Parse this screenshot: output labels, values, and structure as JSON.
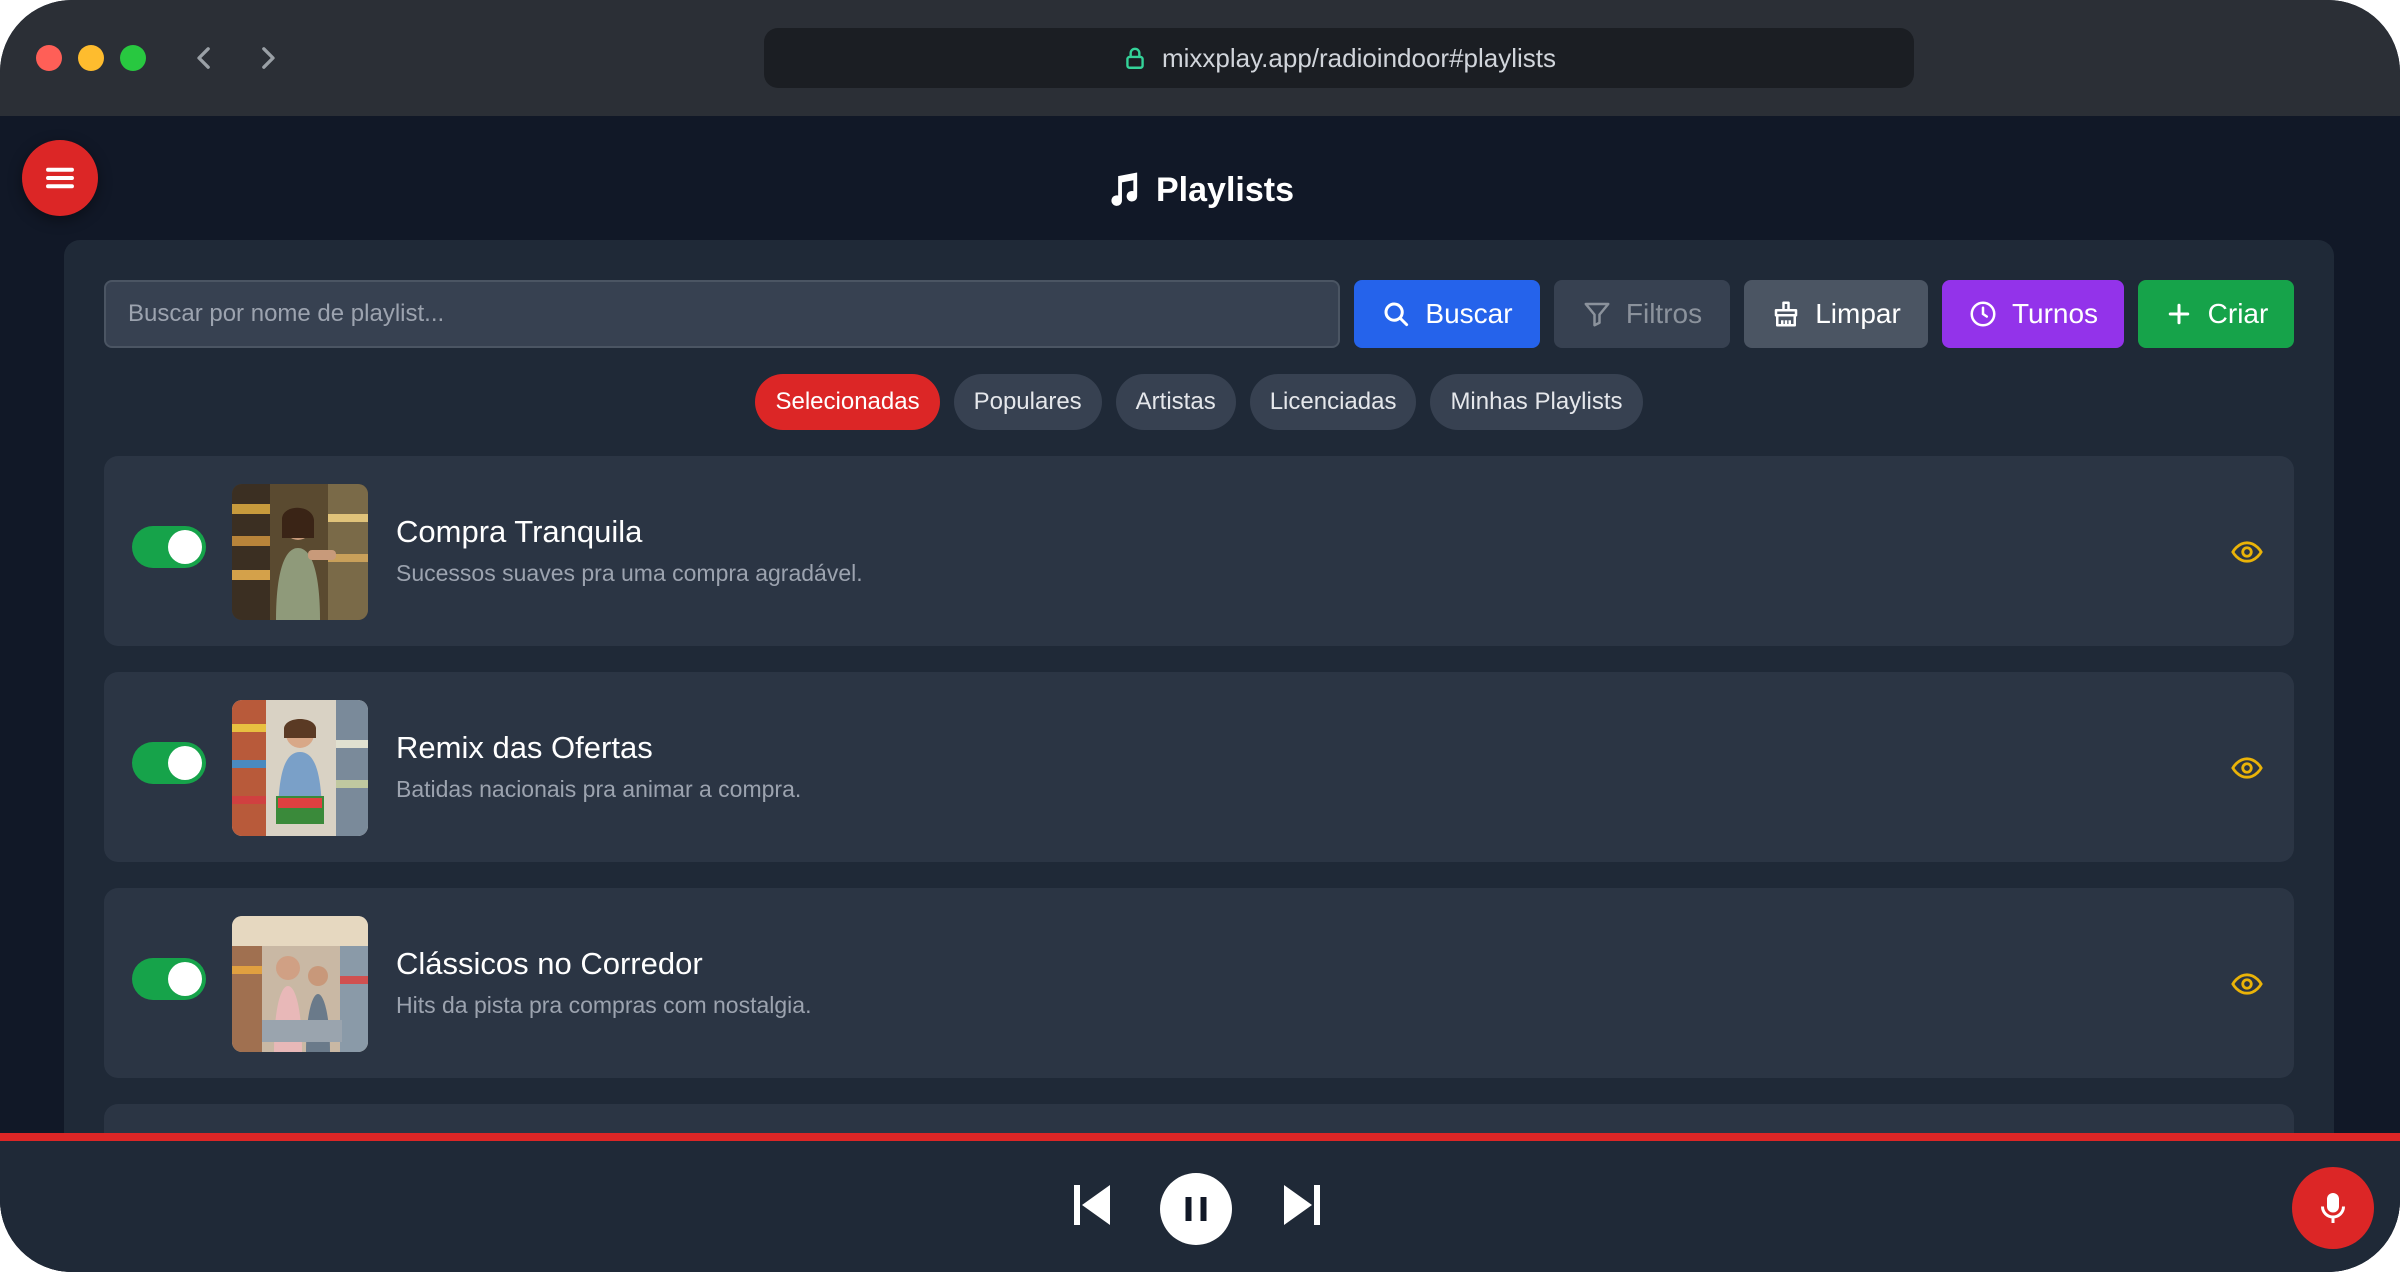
{
  "browser": {
    "url": "mixxplay.app/radioindoor#playlists",
    "icons": [
      "back-icon",
      "forward-icon",
      "lock-icon"
    ]
  },
  "header": {
    "title": "Playlists",
    "icon": "music-note-icon",
    "menu_icon": "hamburger-menu-icon"
  },
  "search": {
    "placeholder": "Buscar por nome de playlist...",
    "value": ""
  },
  "toolbar": {
    "buscar_label": "Buscar",
    "filtros_label": "Filtros",
    "limpar_label": "Limpar",
    "turnos_label": "Turnos",
    "criar_label": "Criar"
  },
  "tabs": [
    {
      "label": "Selecionadas",
      "active": true
    },
    {
      "label": "Populares",
      "active": false
    },
    {
      "label": "Artistas",
      "active": false
    },
    {
      "label": "Licenciadas",
      "active": false
    },
    {
      "label": "Minhas Playlists",
      "active": false
    }
  ],
  "playlists": [
    {
      "title": "Compra Tranquila",
      "description": "Sucessos suaves pra uma compra agradável.",
      "enabled": true
    },
    {
      "title": "Remix das Ofertas",
      "description": "Batidas nacionais pra animar a compra.",
      "enabled": true
    },
    {
      "title": "Clássicos no Corredor",
      "description": "Hits da pista pra compras com nostalgia.",
      "enabled": true
    }
  ],
  "player": {
    "state": "playing",
    "icons": [
      "skip-previous-icon",
      "pause-icon",
      "skip-next-icon",
      "microphone-icon"
    ]
  },
  "colors": {
    "accent_red": "#dc2626",
    "blue": "#2563eb",
    "purple": "#9333ea",
    "green": "#16a34a",
    "eye_yellow": "#eab308",
    "background": "#111827",
    "panel": "#1f2937"
  }
}
